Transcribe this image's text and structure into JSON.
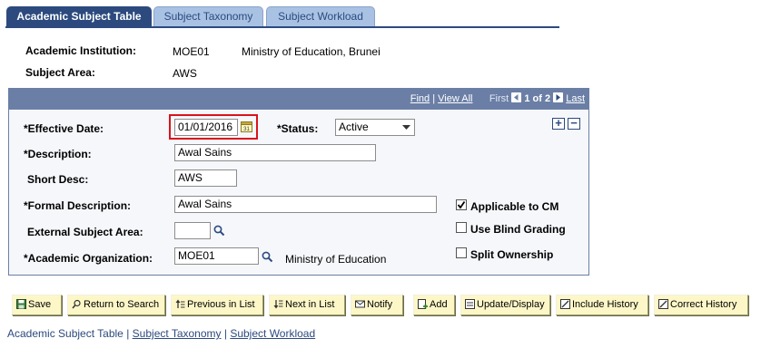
{
  "tabs": [
    {
      "label": "Academic Subject Table",
      "active": true
    },
    {
      "label": "Subject Taxonomy",
      "active": false
    },
    {
      "label": "Subject Workload",
      "active": false
    }
  ],
  "header": {
    "institution_label": "Academic Institution:",
    "institution_code": "MOE01",
    "institution_name": "Ministry of Education, Brunei",
    "subject_area_label": "Subject Area:",
    "subject_area_value": "AWS"
  },
  "panel_nav": {
    "find": "Find",
    "separator": "|",
    "view_all": "View All",
    "first": "First",
    "count": "1 of 2",
    "last": "Last"
  },
  "form": {
    "effective_date_label": "*Effective Date:",
    "effective_date_value": "01/01/2016",
    "status_label": "*Status:",
    "status_value": "Active",
    "description_label": "*Description:",
    "description_value": "Awal Sains",
    "short_desc_label": "Short Desc:",
    "short_desc_value": "AWS",
    "formal_desc_label": "*Formal Description:",
    "formal_desc_value": "Awal Sains",
    "external_area_label": "External Subject Area:",
    "external_area_value": "",
    "acad_org_label": "*Academic Organization:",
    "acad_org_value": "MOE01",
    "acad_org_desc": "Ministry of Education",
    "applicable_cm_label": "Applicable to CM",
    "applicable_cm_checked": true,
    "blind_grading_label": "Use Blind Grading",
    "blind_grading_checked": false,
    "split_ownership_label": "Split Ownership",
    "split_ownership_checked": false
  },
  "toolbar": {
    "save": "Save",
    "return_to_search": "Return to Search",
    "previous_in_list": "Previous in List",
    "next_in_list": "Next in List",
    "notify": "Notify",
    "add": "Add",
    "update_display": "Update/Display",
    "include_history": "Include History",
    "correct_history": "Correct History"
  },
  "footer": {
    "current": "Academic Subject Table",
    "sep1": "|",
    "link1": "Subject Taxonomy",
    "sep2": "|",
    "link2": "Subject Workload"
  },
  "colors": {
    "tab_active_bg": "#2c4a7e",
    "tab_inactive_bg": "#a9c2e4",
    "panel_header": "#6b7fa6",
    "highlight_border": "#d9141b",
    "button_bg": "#fdf7c8"
  },
  "icons": {
    "calendar": "calendar-icon",
    "lookup": "magnifier-icon",
    "add_row": "plus-icon",
    "delete_row": "minus-icon"
  }
}
